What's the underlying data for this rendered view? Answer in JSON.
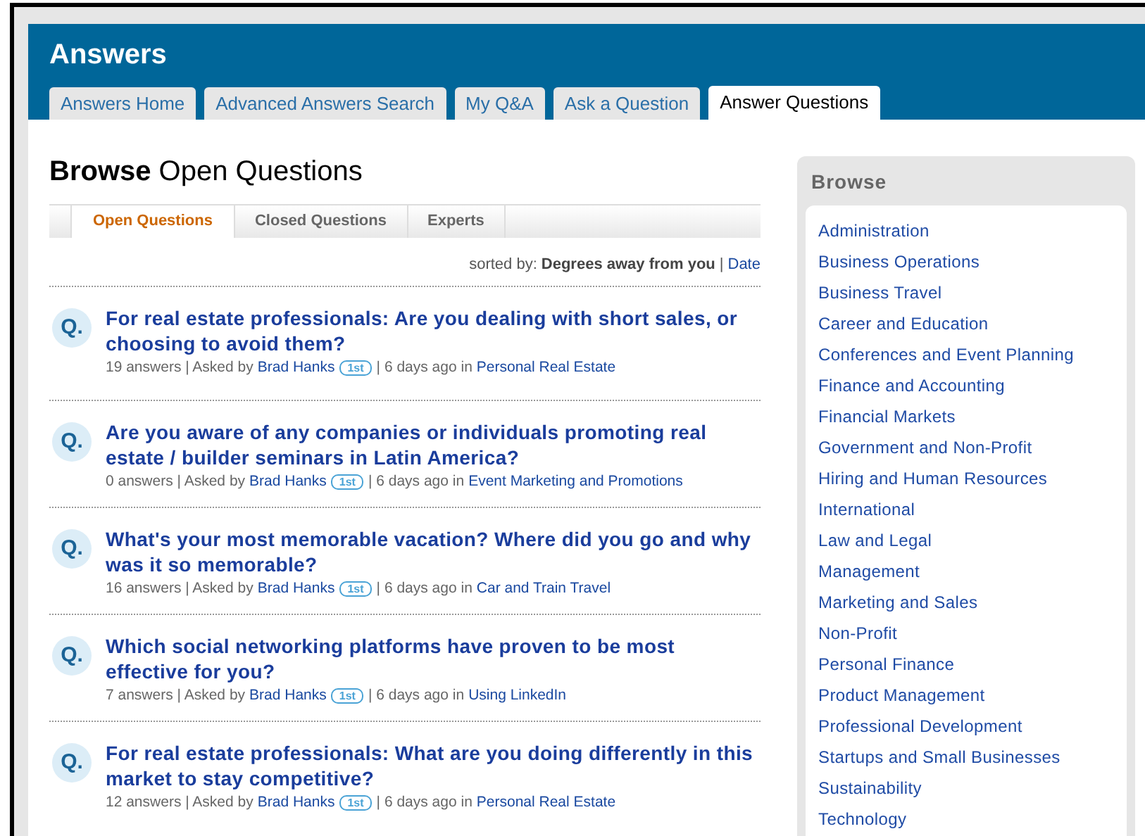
{
  "header": {
    "title": "Answers"
  },
  "tabs": [
    {
      "label": "Answers Home",
      "selected": false
    },
    {
      "label": "Advanced Answers Search",
      "selected": false
    },
    {
      "label": "My Q&A",
      "selected": false
    },
    {
      "label": "Ask a Question",
      "selected": false
    },
    {
      "label": "Answer Questions",
      "selected": true
    }
  ],
  "heading": {
    "bold": "Browse",
    "rest": "Open Questions"
  },
  "subtabs": [
    {
      "label": "Open Questions",
      "selected": true
    },
    {
      "label": "Closed Questions",
      "selected": false
    },
    {
      "label": "Experts",
      "selected": false
    }
  ],
  "sort": {
    "label": "sorted by:",
    "current": "Degrees away from you",
    "separator": "|",
    "alternative": "Date"
  },
  "questions": [
    {
      "marker": "Q.",
      "title": "For real estate professionals: Are you dealing with short sales, or choosing to avoid them?",
      "answers": "19 answers | Asked by",
      "asker": "Brad Hanks",
      "degree": "1st",
      "age": "| 6 days ago in",
      "category": "Personal Real Estate"
    },
    {
      "marker": "Q.",
      "title": "Are you aware of any companies or individuals promoting real estate / builder seminars in Latin America?",
      "answers": "0 answers | Asked by",
      "asker": "Brad Hanks",
      "degree": "1st",
      "age": "| 6 days ago in",
      "category": "Event Marketing and Promotions"
    },
    {
      "marker": "Q.",
      "title": "What's your most memorable vacation? Where did you go and why was it so memorable?",
      "answers": "16 answers | Asked by",
      "asker": "Brad Hanks",
      "degree": "1st",
      "age": "| 6 days ago in",
      "category": "Car and Train Travel"
    },
    {
      "marker": "Q.",
      "title": "Which social networking platforms have proven to be most effective for you?",
      "answers": "7 answers | Asked by",
      "asker": "Brad Hanks",
      "degree": "1st",
      "age": "| 6 days ago in",
      "category": "Using LinkedIn"
    },
    {
      "marker": "Q.",
      "title": "For real estate professionals: What are you doing differently in this market to stay competitive?",
      "answers": "12 answers | Asked by",
      "asker": "Brad Hanks",
      "degree": "1st",
      "age": "| 6 days ago in",
      "category": "Personal Real Estate"
    }
  ],
  "sidebar": {
    "title": "Browse",
    "items": [
      "Administration",
      "Business Operations",
      "Business Travel",
      "Career and Education",
      "Conferences and Event Planning",
      "Finance and Accounting",
      "Financial Markets",
      "Government and Non-Profit",
      "Hiring and Human Resources",
      "International",
      "Law and Legal",
      "Management",
      "Marketing and Sales",
      "Non-Profit",
      "Personal Finance",
      "Product Management",
      "Professional Development",
      "Startups and Small Businesses",
      "Sustainability",
      "Technology"
    ]
  }
}
